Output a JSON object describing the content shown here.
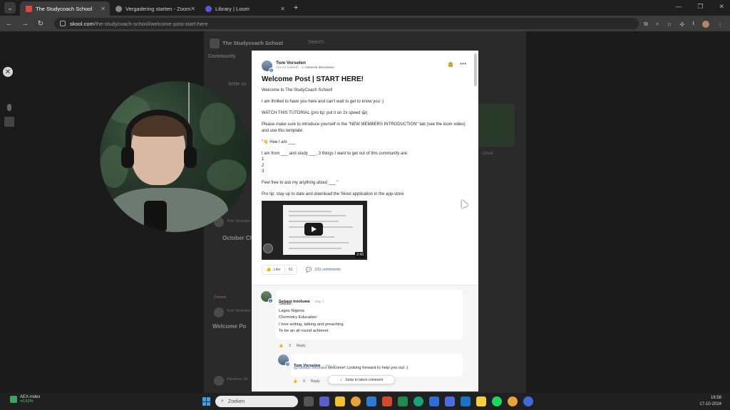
{
  "browser": {
    "tabs": [
      {
        "label": "The Studycoach School",
        "active": true,
        "favicon_color": "#e0473c"
      },
      {
        "label": "Vergadering starten - Zoom",
        "active": false,
        "favicon_color": "#888888"
      },
      {
        "label": "Library | Loom",
        "active": false,
        "favicon_color": "#5b55e0"
      }
    ],
    "url_domain": "skool.com",
    "url_path": "/the-studycoach-school/welcome-post-start-here"
  },
  "background": {
    "group_name": "The Studycoach School",
    "search_placeholder": "Search",
    "tab_community": "Community",
    "write_placeholder": "Write so",
    "author_1": "Tom Vorselen",
    "post_1_title": "October Ch",
    "author_2": "Tom Vorselen",
    "post_2_title": "Welcome Po",
    "pinned": "Pinned",
    "author_3": "Zarzamo Ze",
    "side_title": "chool"
  },
  "post": {
    "author": "Tom Vorselen",
    "meta_date": "Apr 24 (edited) · in",
    "meta_category": "General discussion",
    "title": "Welcome Post | START HERE!",
    "paragraphs": [
      "Welcome to The StudyCoach School!",
      "I am thrilled to have you here and can't wait to get to know you :)",
      "WATCH THIS TUTORIAL (pro tip: put it on 2x speed 😅)",
      "Please make sure to introduce yourself in the \"NEW MEMBERS INTRODUCTION\" tab (see the loom video) and use this template:",
      "\"👋 Hee I am ___"
    ],
    "template_line": "I am from ___ and study ___. 3 things I want to get out of this community are:",
    "list": [
      "1",
      "2",
      "3"
    ],
    "closing": "Feel free to ask my anything about ___ \"",
    "pro_tip": "Pro tip: stay up to date and download the Skool application in the app-store",
    "video_duration": "2:43",
    "like_label": "Like",
    "like_count": "52",
    "comments_count": "231 comments"
  },
  "comments": [
    {
      "author": "Sebasi Inioluwa",
      "date": "· May 7",
      "lines": [
        "Sebasi",
        "Lagos Nigeria",
        "Chemistry Education",
        "I love writing, talking and preaching",
        "To be an all round achiever"
      ],
      "likes": "3",
      "reply_label": "Reply"
    },
    {
      "author": "Tom Vorselen",
      "date": "· May 14",
      "mention": "@Sebasi Inioluwa",
      "text": " welcome! Looking forward to help you out :)",
      "likes": "0",
      "reply_label": "Reply"
    }
  ],
  "jump_label": "Jump to latest comment",
  "taskbar": {
    "widget_title": "AEX-index",
    "widget_value": "+0,62%",
    "search_placeholder": "Zoeken",
    "time": "16:58",
    "date": "17-10-2024"
  }
}
